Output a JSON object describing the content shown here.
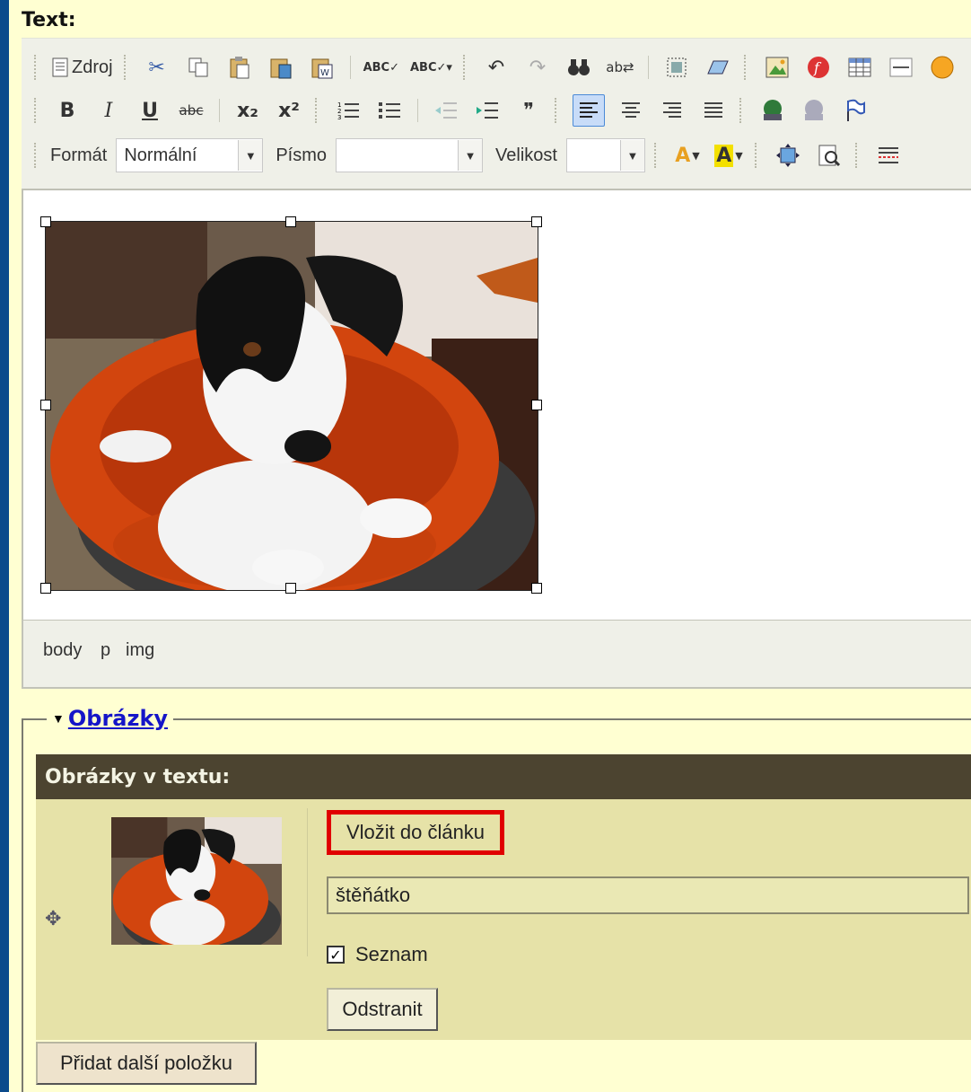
{
  "editor": {
    "field_label": "Text:",
    "toolbar": {
      "source_label": "Zdroj",
      "format_label": "Formát",
      "format_value": "Normální",
      "font_label": "Písmo",
      "font_value": "",
      "size_label": "Velikost",
      "size_value": "",
      "bold": "B",
      "italic": "I",
      "underline": "U",
      "strike": "abc",
      "subscript": "x₂",
      "superscript": "x²",
      "quote": "❞",
      "text_color": "A",
      "bg_color": "A"
    },
    "path": [
      "body",
      "p",
      "img"
    ]
  },
  "images_section": {
    "legend": "Obrázky",
    "panel_title": "Obrázky v textu:",
    "item": {
      "insert_button": "Vložit do článku",
      "caption_value": "štěňátko",
      "list_checkbox_label": "Seznam",
      "list_checked": true,
      "remove_button": "Odstranit"
    },
    "add_button": "Přidat další položku"
  },
  "colors": {
    "page_bg": "#ffffd2",
    "outer_bg": "#0b4a8b",
    "panel_header": "#4c4430",
    "panel_body": "#e6e2a8",
    "highlight_border": "#e00000"
  }
}
